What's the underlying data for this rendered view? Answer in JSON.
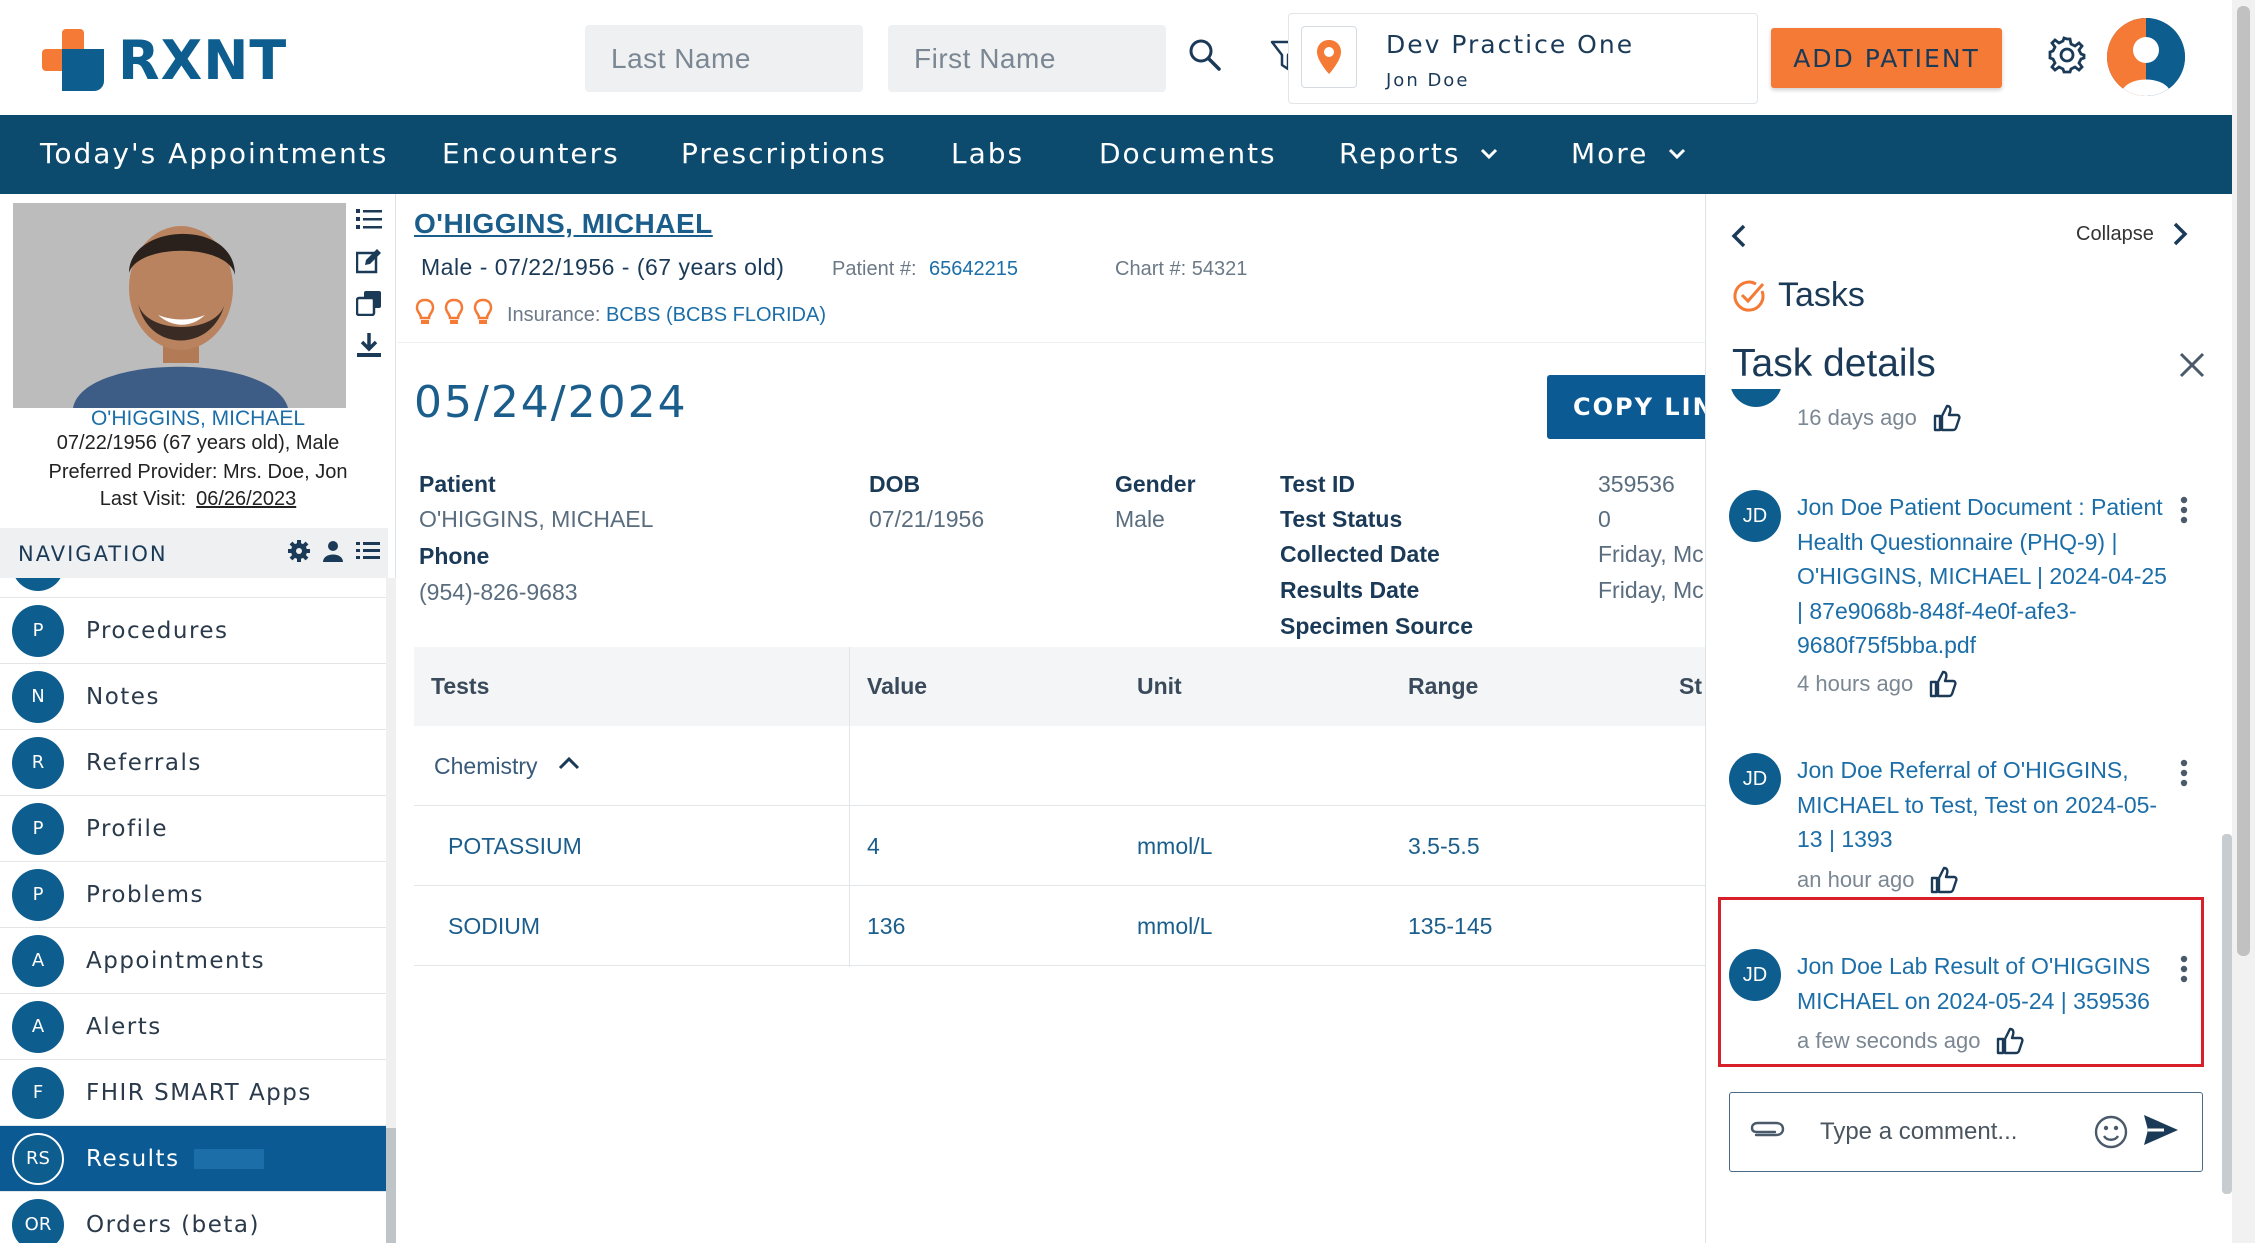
{
  "header": {
    "logo_text": "RXNT",
    "last_name_placeholder": "Last Name",
    "first_name_placeholder": "First Name",
    "practice_name": "Dev Practice One",
    "practice_user": "Jon Doe",
    "add_patient_label": "ADD PATIENT",
    "brand_orange": "#f47a35",
    "brand_blue": "#0d5d8f"
  },
  "navbar": {
    "items": [
      {
        "label": "Today's Appointments"
      },
      {
        "label": "Encounters"
      },
      {
        "label": "Prescriptions"
      },
      {
        "label": "Labs"
      },
      {
        "label": "Documents"
      },
      {
        "label": "Reports"
      },
      {
        "label": "More"
      }
    ]
  },
  "sidebar": {
    "patient_name": "O'HIGGINS, MICHAEL",
    "patient_dob": "07/22/1956 (67 years old), Male",
    "provider": "Preferred Provider: Mrs. Doe, Jon",
    "last_visit_label": "Last Visit:",
    "last_visit_date": "06/26/2023",
    "nav_title": "NAVIGATION",
    "nav_items": [
      {
        "initials": "P",
        "label": "Procedures"
      },
      {
        "initials": "N",
        "label": "Notes"
      },
      {
        "initials": "R",
        "label": "Referrals"
      },
      {
        "initials": "P",
        "label": "Profile"
      },
      {
        "initials": "P",
        "label": "Problems"
      },
      {
        "initials": "A",
        "label": "Appointments"
      },
      {
        "initials": "A",
        "label": "Alerts"
      },
      {
        "initials": "F",
        "label": "FHIR SMART Apps"
      },
      {
        "initials": "RS",
        "label": "Results"
      },
      {
        "initials": "OR",
        "label": "Orders (beta)"
      }
    ]
  },
  "patient": {
    "name": "O'HIGGINS, MICHAEL",
    "gender_dob": "Male - 07/22/1956 - (67 years old)",
    "patient_number_label": "Patient #:",
    "patient_number": "65642215",
    "chart_number": "Chart #: 54321",
    "insurance_label": "Insurance:",
    "insurance_value": "BCBS (BCBS FLORIDA)"
  },
  "result": {
    "date": "05/24/2024",
    "copy_link_label": "COPY LINK",
    "patient_label": "Patient",
    "patient_value": "O'HIGGINS, MICHAEL",
    "phone_label": "Phone",
    "phone_value": "(954)-826-9683",
    "dob_label": "DOB",
    "dob_value": "07/21/1956",
    "gender_label": "Gender",
    "gender_value": "Male",
    "test_id_label": "Test ID",
    "test_id_value": "359536",
    "test_status_label": "Test Status",
    "test_status_value": "0",
    "collected_label": "Collected Date",
    "collected_value": "Friday, Mc",
    "results_date_label": "Results Date",
    "results_date_value": "Friday, Mc",
    "specimen_label": "Specimen Source",
    "table": {
      "headers": [
        "Tests",
        "Value",
        "Unit",
        "Range",
        "St"
      ],
      "group": "Chemistry",
      "rows": [
        {
          "test": "POTASSIUM",
          "value": "4",
          "unit": "mmol/L",
          "range": "3.5-5.5"
        },
        {
          "test": "SODIUM",
          "value": "136",
          "unit": "mmol/L",
          "range": "135-145"
        }
      ]
    }
  },
  "tasks_panel": {
    "collapse_label": "Collapse",
    "tasks_title": "Tasks",
    "details_title": "Task details",
    "first_time": "16 days ago",
    "items": [
      {
        "initials": "JD",
        "text": "Jon Doe Patient Document : Patient Health Questionnaire (PHQ-9) | O'HIGGINS, MICHAEL | 2024-04-25 | 87e9068b-848f-4e0f-afe3-9680f75f5bba.pdf",
        "time": "4 hours ago"
      },
      {
        "initials": "JD",
        "text": "Jon Doe Referral of O'HIGGINS, MICHAEL to Test, Test on 2024-05-13 | 1393",
        "time": "an hour ago"
      },
      {
        "initials": "JD",
        "text": "Jon Doe Lab Result of O'HIGGINS MICHAEL on 2024-05-24 | 359536",
        "time": "a few seconds ago"
      }
    ],
    "comment_placeholder": "Type a comment..."
  }
}
